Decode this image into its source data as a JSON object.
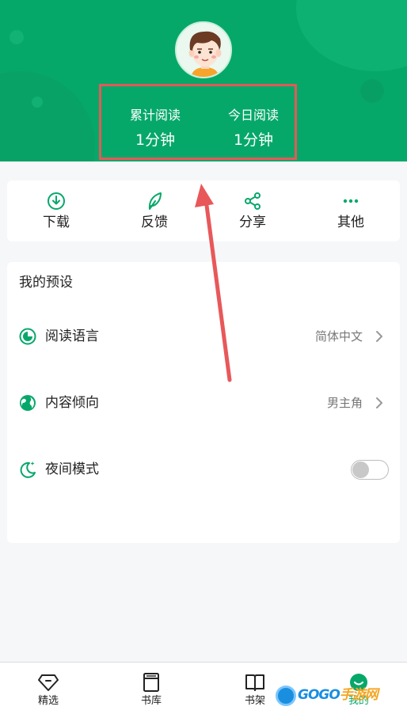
{
  "header": {
    "stats": [
      {
        "label": "累计阅读",
        "value": "1分钟"
      },
      {
        "label": "今日阅读",
        "value": "1分钟"
      }
    ]
  },
  "actions": [
    {
      "label": "下载",
      "icon": "download-icon"
    },
    {
      "label": "反馈",
      "icon": "feather-icon"
    },
    {
      "label": "分享",
      "icon": "share-icon"
    },
    {
      "label": "其他",
      "icon": "more-icon"
    }
  ],
  "preferences": {
    "title": "我的预设",
    "items": [
      {
        "label": "阅读语言",
        "value": "简体中文",
        "icon": "language-icon"
      },
      {
        "label": "内容倾向",
        "value": "男主角",
        "icon": "globe-icon"
      },
      {
        "label": "夜间模式",
        "icon": "moon-icon",
        "toggle_on": false
      }
    ]
  },
  "bottom_nav": [
    {
      "label": "精选",
      "icon": "diamond-icon",
      "active": false
    },
    {
      "label": "书库",
      "icon": "library-icon",
      "active": false
    },
    {
      "label": "书架",
      "icon": "bookshelf-icon",
      "active": false
    },
    {
      "label": "我的",
      "icon": "profile-icon",
      "active": true
    }
  ],
  "watermark": {
    "text_blue": "GOGO",
    "text_gold": "手游网"
  },
  "colors": {
    "primary": "#06a86a",
    "highlight_box": "#e25a57",
    "arrow": "#e8585a"
  }
}
